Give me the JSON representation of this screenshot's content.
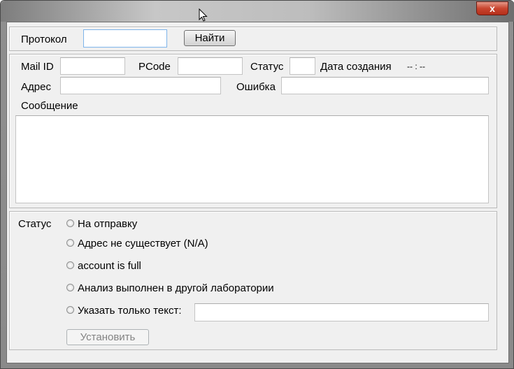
{
  "window": {
    "close_glyph": "x"
  },
  "search": {
    "protocol_label": "Протокол",
    "protocol_value": "",
    "find_button": "Найти"
  },
  "details": {
    "mail_id_label": "Mail ID",
    "mail_id_value": "",
    "pcode_label": "PCode",
    "pcode_value": "",
    "status_label": "Статус",
    "status_value": "",
    "created_label": "Дата создания",
    "created_value": "-- : --",
    "address_label": "Адрес",
    "address_value": "",
    "error_label": "Ошибка",
    "error_value": "",
    "message_label": "Сообщение",
    "message_value": ""
  },
  "status_group": {
    "label": "Статус",
    "options": [
      {
        "label": "На отправку",
        "selected": false
      },
      {
        "label": "Адрес не существует (N/A)",
        "selected": false
      },
      {
        "label": "account is full",
        "selected": false
      },
      {
        "label": "Анализ выполнен в другой лаборатории",
        "selected": false
      },
      {
        "label": "Указать только текст:",
        "selected": false
      }
    ],
    "custom_text_value": "",
    "apply_button": "Установить"
  },
  "icons": {
    "close": "close-icon",
    "cursor": "mouse-cursor-icon",
    "radio": "radio-button"
  }
}
